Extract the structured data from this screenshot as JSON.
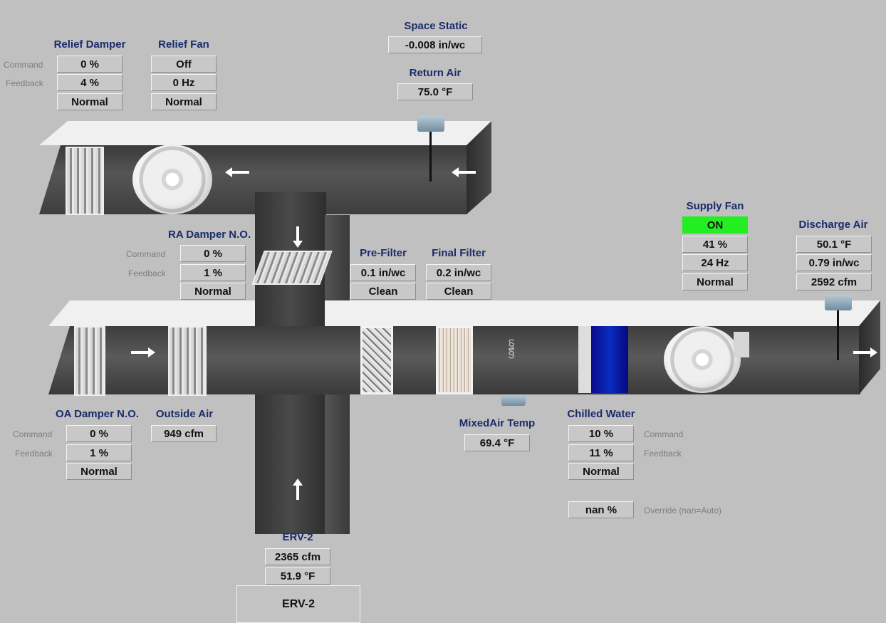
{
  "space_static": {
    "title": "Space Static",
    "value": "-0.008 in/wc"
  },
  "return_air": {
    "title": "Return Air",
    "temp": "75.0 °F"
  },
  "relief_damper": {
    "title": "Relief Damper",
    "command": "0 %",
    "feedback": "4 %",
    "status": "Normal"
  },
  "relief_fan": {
    "title": "Relief Fan",
    "command": "Off",
    "feedback": "0 Hz",
    "status": "Normal"
  },
  "labels": {
    "command": "Command",
    "feedback": "Feedback",
    "override": "Override (nan=Auto)"
  },
  "ra_damper": {
    "title": "RA Damper N.O.",
    "command": "0 %",
    "feedback": "1 %",
    "status": "Normal"
  },
  "pre_filter": {
    "title": "Pre-Filter",
    "value": "0.1 in/wc",
    "status": "Clean"
  },
  "final_filter": {
    "title": "Final Filter",
    "value": "0.2 in/wc",
    "status": "Clean"
  },
  "supply_fan": {
    "title": "Supply Fan",
    "state": "ON",
    "speed_pct": "41 %",
    "speed_hz": "24 Hz",
    "status": "Normal"
  },
  "discharge_air": {
    "title": "Discharge Air",
    "temp": "50.1 °F",
    "static": "0.79 in/wc",
    "flow": "2592 cfm"
  },
  "oa_damper": {
    "title": "OA Damper N.O.",
    "command": "0 %",
    "feedback": "1 %",
    "status": "Normal"
  },
  "outside_air": {
    "title": "Outside Air",
    "flow": "949 cfm"
  },
  "mixed_air": {
    "title": "MixedAir Temp",
    "temp": "69.4 °F"
  },
  "chilled_water": {
    "title": "Chilled Water",
    "command": "10 %",
    "feedback": "11 %",
    "status": "Normal",
    "override": "nan %"
  },
  "erv": {
    "title": "ERV-2",
    "flow": "2365 cfm",
    "temp": "51.9 °F",
    "button_label": "ERV-2"
  },
  "colors": {
    "background": "#c0c0c0",
    "title": "#1b2b6b",
    "on": "#22ee22"
  }
}
